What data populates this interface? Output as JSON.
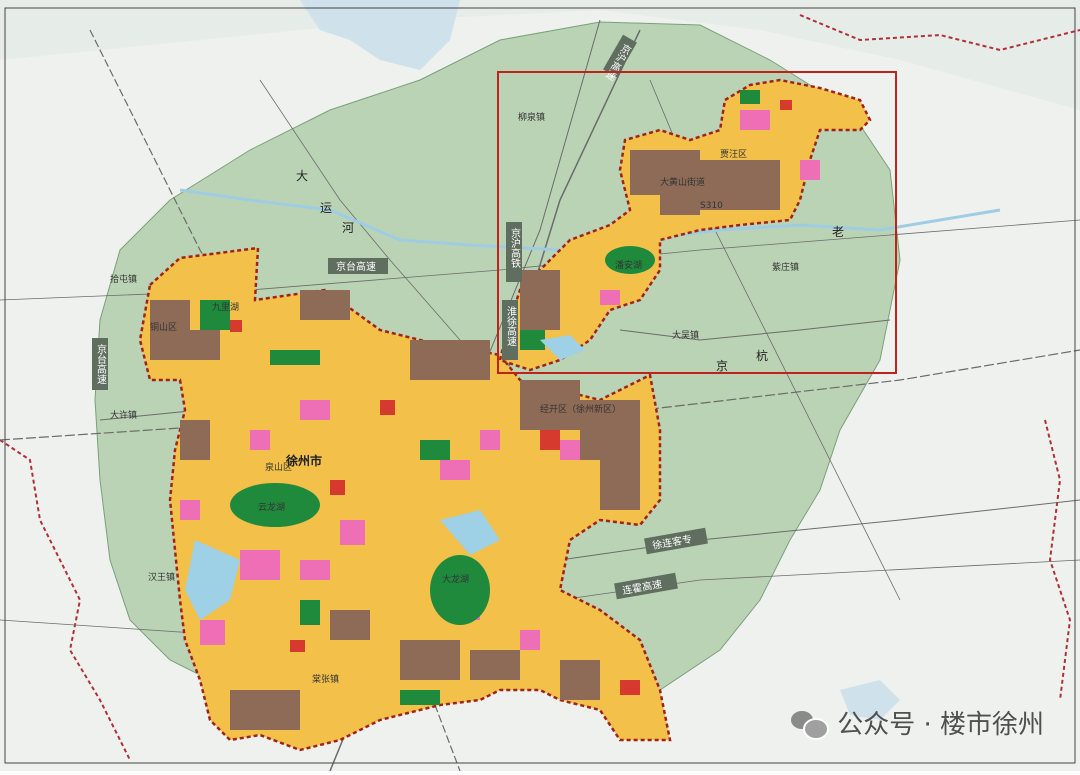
{
  "colors": {
    "background": "#eef1ee",
    "green_ring": "#a8c8a0",
    "residential": "#f3c04a",
    "commercial": "#ef6fb6",
    "industrial": "#8d6b57",
    "park": "#1f8a3c",
    "public": "#d63a2e",
    "boundary": "#a0221a",
    "highlight_frame": "#c0221c",
    "water": "#9ed0e6",
    "road": "#5a5a5a"
  },
  "labels": {
    "city": "徐州市",
    "yunlong": "云龙湖",
    "dalong": "大龙湖",
    "pan_an": "潘安湖",
    "jiulong": "九里湖",
    "tongshan": "泉山区",
    "tongshan2": "铜山区",
    "jiawang": "贾汪区",
    "kaifa": "经开区（徐州新区）",
    "s310": "S310",
    "dahuangshan": "大黄山街道",
    "hanwang": "汉王镇",
    "dawu": "大吴镇",
    "liuji": "柳泉镇",
    "xiaozhuang": "拾屯镇",
    "daxu": "大许镇",
    "ziyuan": "紫庄镇",
    "tangzhang": "棠张镇"
  },
  "roads": {
    "jingtai_h": "京台高速",
    "jingtai_v": "京台高速",
    "jinghu": "京沪高铁",
    "huaixu": "淮徐高速",
    "lianxu": "连霍高速",
    "xulian": "徐连客专",
    "jinghu2": "京沪高速",
    "dayun_1": "大",
    "dayun_2": "运",
    "dayun_3": "河",
    "ji": "杭",
    "ji2": "京",
    "lao": "老"
  },
  "watermark": {
    "text": "公众号 · 楼市徐州"
  }
}
